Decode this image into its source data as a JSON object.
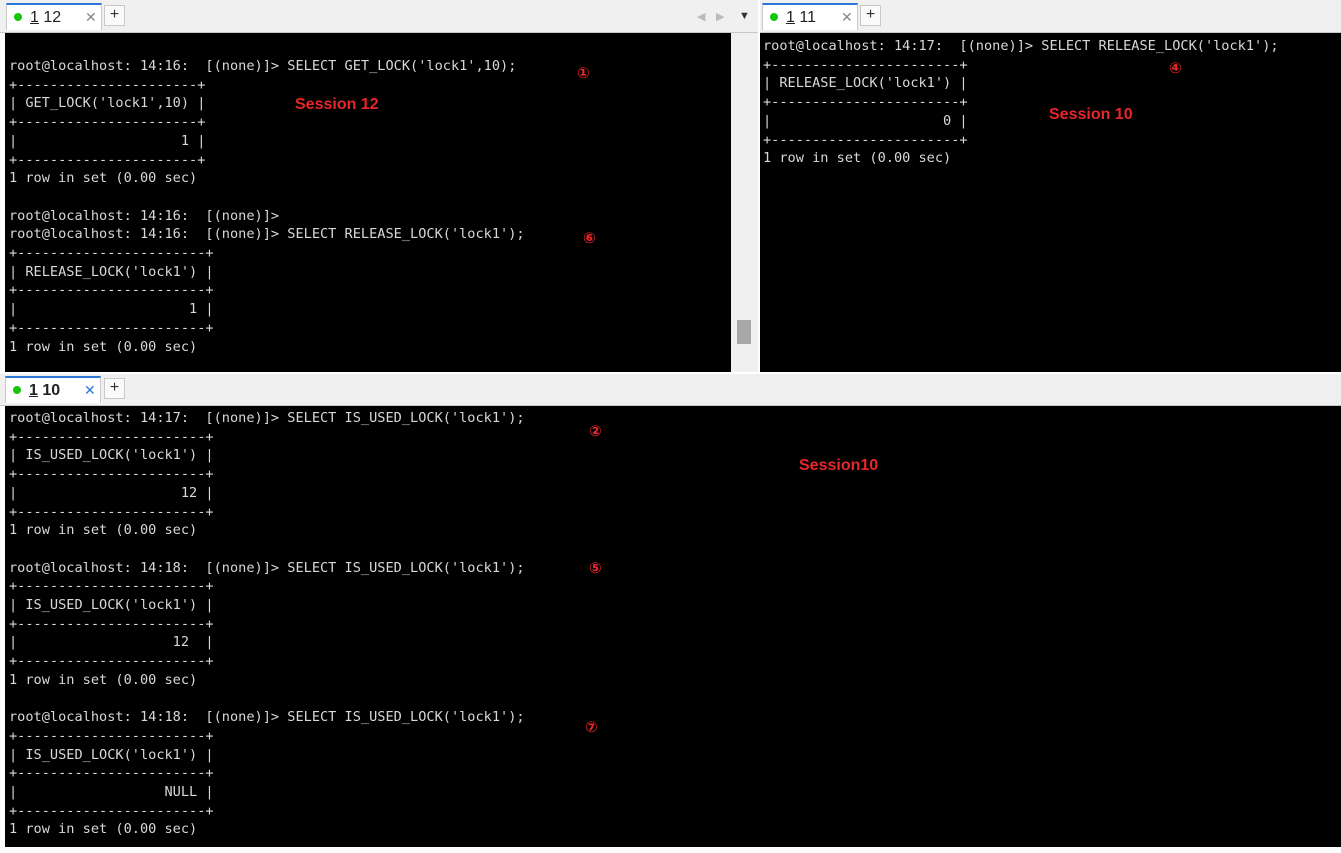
{
  "tabs": {
    "left": {
      "num": "1",
      "label": "12",
      "close": "✕",
      "add": "+"
    },
    "right": {
      "num": "1",
      "label": "11",
      "close": "✕",
      "add": "+"
    },
    "bottom": {
      "num": "1",
      "label": "10",
      "close": "✕",
      "add": "+"
    },
    "nav_prev": "◀",
    "nav_next": "▶",
    "nav_menu": "▼"
  },
  "panes": {
    "left": [
      "root@localhost: 14:16:  [(none)]> SELECT GET_LOCK('lock1',10);",
      "+----------------------+",
      "| GET_LOCK('lock1',10) |",
      "+----------------------+",
      "|                    1 |",
      "+----------------------+",
      "1 row in set (0.00 sec)",
      "",
      "root@localhost: 14:16:  [(none)]>",
      "root@localhost: 14:16:  [(none)]> SELECT RELEASE_LOCK('lock1');",
      "+-----------------------+",
      "| RELEASE_LOCK('lock1') |",
      "+-----------------------+",
      "|                     1 |",
      "+-----------------------+",
      "1 row in set (0.00 sec)"
    ],
    "right": [
      "root@localhost: 14:17:  [(none)]> SELECT RELEASE_LOCK('lock1');",
      "+-----------------------+",
      "| RELEASE_LOCK('lock1') |",
      "+-----------------------+",
      "|                     0 |",
      "+-----------------------+",
      "1 row in set (0.00 sec)"
    ],
    "bottom": [
      "root@localhost: 14:17:  [(none)]> SELECT IS_USED_LOCK('lock1');",
      "+-----------------------+",
      "| IS_USED_LOCK('lock1') |",
      "+-----------------------+",
      "|                    12 |",
      "+-----------------------+",
      "1 row in set (0.00 sec)",
      "",
      "root@localhost: 14:18:  [(none)]> SELECT IS_USED_LOCK('lock1');",
      "+-----------------------+",
      "| IS_USED_LOCK('lock1') |",
      "+-----------------------+",
      "|                   12  |",
      "+-----------------------+",
      "1 row in set (0.00 sec)",
      "",
      "root@localhost: 14:18:  [(none)]> SELECT IS_USED_LOCK('lock1');",
      "+-----------------------+",
      "| IS_USED_LOCK('lock1') |",
      "+-----------------------+",
      "|                  NULL |",
      "+-----------------------+",
      "1 row in set (0.00 sec)"
    ]
  },
  "annotations": {
    "session_left": "Session 12",
    "session_right": "Session 10",
    "session_bottom": "Session10",
    "step1": "①",
    "step2": "②",
    "step4": "④",
    "step5": "⑤",
    "step6": "⑥",
    "step7": "⑦"
  },
  "colors": {
    "annotation": "#e8262a",
    "terminal_bg": "#000000",
    "terminal_fg": "#d8d8d8",
    "tab_dot": "#16c60c",
    "active_tab": "#2b78d6"
  }
}
